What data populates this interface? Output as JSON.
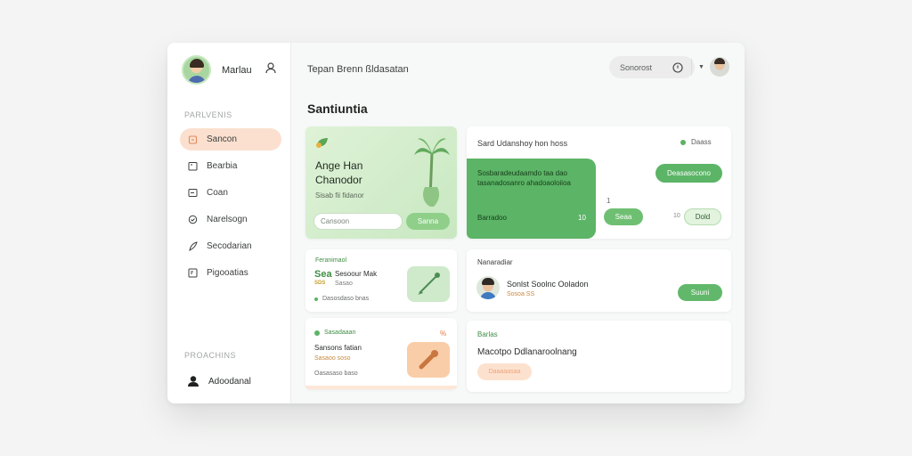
{
  "sidebar": {
    "profile_name": "Marlau",
    "section1_label": "PARLVENIS",
    "items": [
      {
        "label": "Sancon",
        "icon": "home-icon",
        "active": true
      },
      {
        "label": "Bearbia",
        "icon": "calendar-icon",
        "active": false
      },
      {
        "label": "Coan",
        "icon": "card-icon",
        "active": false
      },
      {
        "label": "Narelsogn",
        "icon": "settings-icon",
        "active": false
      },
      {
        "label": "Secodarian",
        "icon": "feather-icon",
        "active": false
      },
      {
        "label": "Pigooatias",
        "icon": "document-icon",
        "active": false
      }
    ],
    "section2_label": "PROACHINS",
    "bottom_item": "Adoodanal"
  },
  "topbar": {
    "title": "Tepan Brenn ßldasatan",
    "search_label": "Sonorost"
  },
  "page_title": "Santiuntia",
  "promo": {
    "title": "Ange Han Chanodor",
    "subtitle": "Sisab fii fidanor",
    "input_placeholder": "Cansoon",
    "button_label": "Sanna"
  },
  "wide_card": {
    "title": "Sard Udanshoy hon hoss",
    "status": "Daass",
    "green_text": "Sosbaradeudaamdo taa dao tasanadosanro ahadoaoloiioa",
    "green_bottom": "Barradoo",
    "green_count": "10",
    "button1": "Deasasocono",
    "mark": "1",
    "button2": "Seaa",
    "x_mark": "10",
    "button3": "Dold"
  },
  "small1": {
    "label": "Feranimaol",
    "big": "Sea",
    "tiny": "SDS",
    "title": "Sesoour Mak",
    "subtitle": "Sasao",
    "line": "Dasosdaso bnas"
  },
  "small2": {
    "label": "Sasadaaan",
    "mark": "%",
    "title": "Sansons fatian",
    "subtitle": "Sasaoo soso",
    "line": "Oasasaso baso"
  },
  "mid_card": {
    "label": "Nanaradiar",
    "title": "Sonlst Soolnc Ooladon",
    "subtitle": "Sosoa SS",
    "button": "Suuni"
  },
  "bot_card": {
    "label": "Barlas",
    "title": "Macotpo Ddlanaroolnang",
    "button": "Daaaaasaa"
  },
  "colors": {
    "accent_green": "#5cb466",
    "accent_peach": "#fbe0cf"
  }
}
